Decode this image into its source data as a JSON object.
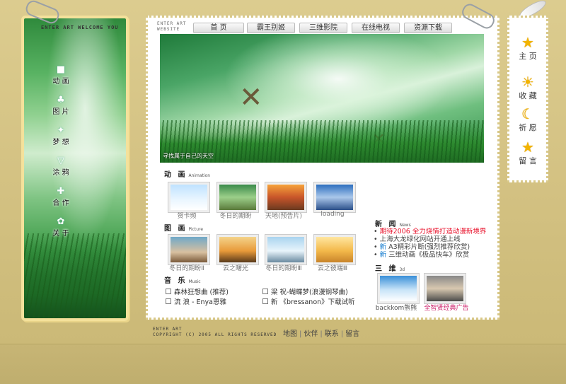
{
  "site": {
    "left_title": "ENTER ART  WELCOME YOU",
    "brand_line1": "ENTER ART",
    "brand_line2": "WEBSITE"
  },
  "left_nav": [
    {
      "label": "动 画",
      "icon": "camera-icon"
    },
    {
      "label": "图 片",
      "icon": "tulip-icon"
    },
    {
      "label": "梦 想",
      "icon": "sparkle-icon"
    },
    {
      "label": "涂 鸦",
      "icon": "cup-icon"
    },
    {
      "label": "合 作",
      "icon": "plus-icon"
    },
    {
      "label": "关 于",
      "icon": "flower-icon"
    }
  ],
  "top_nav": [
    {
      "label": "首  页"
    },
    {
      "label": "霸王别姬"
    },
    {
      "label": "三维影院"
    },
    {
      "label": "在线电视"
    },
    {
      "label": "资源下载"
    }
  ],
  "banner": {
    "caption": "寻找属于自己的天空"
  },
  "animation": {
    "title": "动 画",
    "en": "Animation",
    "items": [
      {
        "caption": "贺卡频"
      },
      {
        "caption": "冬日的期盼"
      },
      {
        "caption": "天地(预告片)"
      },
      {
        "caption": "loading"
      }
    ]
  },
  "picture": {
    "title": "图 画",
    "en": "Picture",
    "items": [
      {
        "caption": "冬日的期盼Ⅱ"
      },
      {
        "caption": "云之曙光"
      },
      {
        "caption": "冬日的期盼Ⅲ"
      },
      {
        "caption": "云之彼端Ⅲ"
      }
    ]
  },
  "music": {
    "title": "音 乐",
    "en": "Music",
    "items": [
      {
        "label": "森林狂想曲 (推荐)"
      },
      {
        "label": "梁 祝-蝴蝶梦(浪漫钢琴曲)"
      },
      {
        "label": "流 浪 - Enya恩雅"
      },
      {
        "label": "新 《bressanon》下载试听"
      }
    ]
  },
  "news": {
    "title": "新 闻",
    "en": "News",
    "items": [
      {
        "prefix": "",
        "text": "期待2006 全力烧情打造动漫新境界!",
        "color": "#e8102a"
      },
      {
        "prefix": "",
        "text": "上海大龙绿化网站开通上线",
        "color": "#444444"
      },
      {
        "prefix": "新",
        "text": " A3精彩片断(强烈推荐欣赏)",
        "color": "#444444"
      },
      {
        "prefix": "新",
        "text": " 三维动画《极品快车》欣赏",
        "color": "#444444"
      }
    ]
  },
  "threed": {
    "title": "三 维",
    "en": "3d",
    "items": [
      {
        "caption": "backkom熊熊",
        "color": "#555555"
      },
      {
        "caption": "全智贤经典广告",
        "color": "#cc1f6a"
      }
    ]
  },
  "right_nav": [
    {
      "label": "主 页",
      "icon": "star-icon"
    },
    {
      "label": "收 藏",
      "icon": "sunrise-icon"
    },
    {
      "label": "祈 愿",
      "icon": "moon-icon"
    },
    {
      "label": "留 言",
      "icon": "star-icon"
    }
  ],
  "footer": {
    "brand_line1": "ENTER ART",
    "brand_line2": "COPYRIGHT (C) 2005 ALL RIGHTS RESERVED",
    "links": [
      {
        "label": "地图"
      },
      {
        "label": "伙伴"
      },
      {
        "label": "联系"
      },
      {
        "label": "留言"
      }
    ]
  }
}
